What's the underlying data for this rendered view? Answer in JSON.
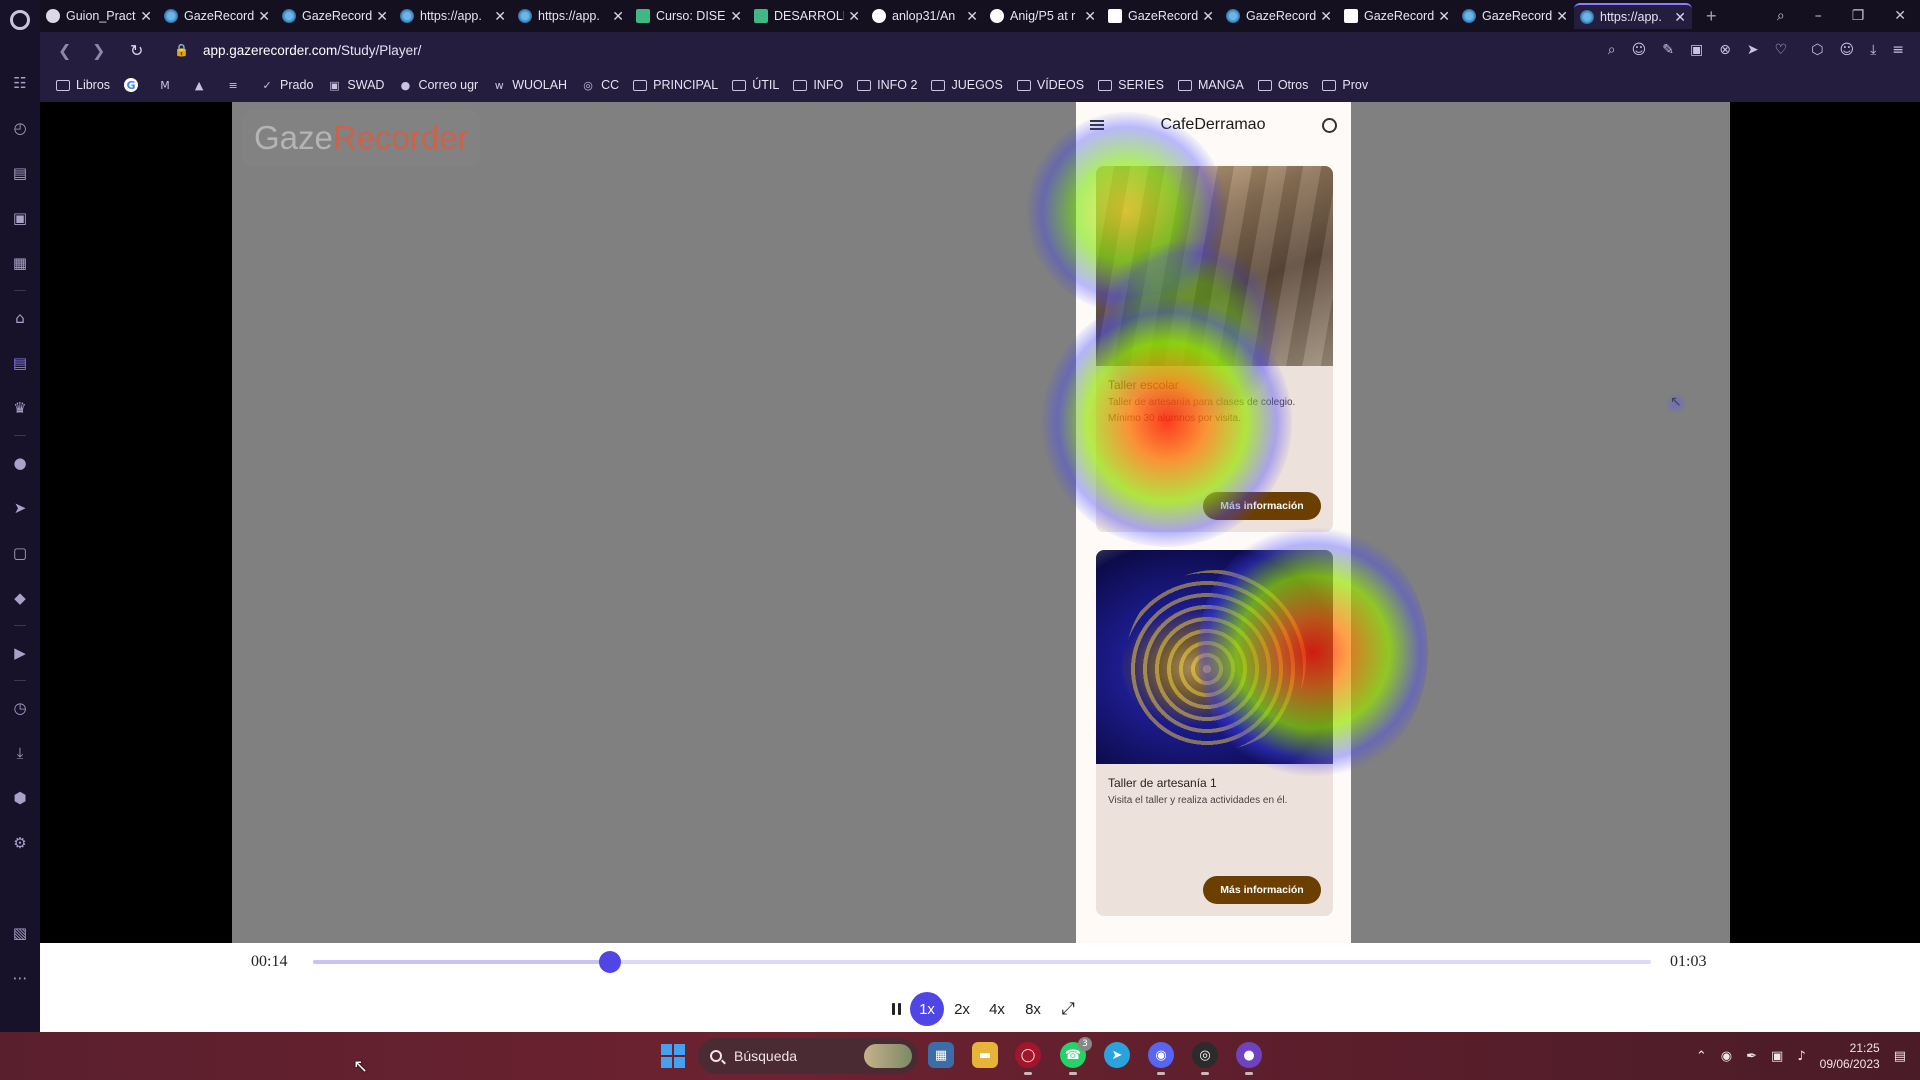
{
  "browser": {
    "tabs": [
      {
        "title": "Guion_Pract",
        "favicon": "opera-icon",
        "active": false
      },
      {
        "title": "GazeRecord",
        "favicon": "gazerecorder-icon",
        "active": false
      },
      {
        "title": "GazeRecord",
        "favicon": "gazerecorder-icon",
        "active": false
      },
      {
        "title": "https://app.",
        "favicon": "gazerecorder-icon",
        "active": false
      },
      {
        "title": "https://app.",
        "favicon": "gazerecorder-icon",
        "active": false
      },
      {
        "title": "Curso: DISE",
        "favicon": "vue-icon",
        "active": false
      },
      {
        "title": "DESARROLL",
        "favicon": "vue-icon",
        "active": false
      },
      {
        "title": "anlop31/An",
        "favicon": "github-icon",
        "active": false
      },
      {
        "title": "Anig/P5 at r",
        "favicon": "github-icon",
        "active": false
      },
      {
        "title": "GazeRecord",
        "favicon": "gmail-icon",
        "active": false
      },
      {
        "title": "GazeRecord",
        "favicon": "gazerecorder-icon",
        "active": false
      },
      {
        "title": "GazeRecord",
        "favicon": "gmail-icon",
        "active": false
      },
      {
        "title": "GazeRecord",
        "favicon": "gazerecorder-icon",
        "active": false
      },
      {
        "title": "https://app.",
        "favicon": "gazerecorder-icon",
        "active": true
      }
    ],
    "new_tab_label": "+",
    "url_host": "app.gazerecorder.com",
    "url_path": "/Study/Player/",
    "bookmarks": [
      {
        "label": "Libros",
        "icon": "folder-icon"
      },
      {
        "label": "",
        "icon": "google-icon"
      },
      {
        "label": "",
        "icon": "gmail-icon"
      },
      {
        "label": "",
        "icon": "drive-icon"
      },
      {
        "label": "",
        "icon": "docs-icon"
      },
      {
        "label": "Prado",
        "icon": "prado-icon"
      },
      {
        "label": "SWAD",
        "icon": "swad-icon"
      },
      {
        "label": "Correo ugr",
        "icon": "ugr-icon"
      },
      {
        "label": "WUOLAH",
        "icon": "wuolah-icon"
      },
      {
        "label": "CC",
        "icon": "cc-icon"
      },
      {
        "label": "PRINCIPAL",
        "icon": "folder-icon"
      },
      {
        "label": "ÚTIL",
        "icon": "folder-icon"
      },
      {
        "label": "INFO",
        "icon": "folder-icon"
      },
      {
        "label": "INFO 2",
        "icon": "folder-icon"
      },
      {
        "label": "JUEGOS",
        "icon": "folder-icon"
      },
      {
        "label": "VÍDEOS",
        "icon": "folder-icon"
      },
      {
        "label": "SERIES",
        "icon": "folder-icon"
      },
      {
        "label": "MANGA",
        "icon": "folder-icon"
      },
      {
        "label": "Otros",
        "icon": "folder-icon"
      },
      {
        "label": "Prov",
        "icon": "folder-icon"
      }
    ]
  },
  "overlay": {
    "logo_part1": "Gaze",
    "logo_part2": "Recorder"
  },
  "phone": {
    "app_title": "CafeDerramao",
    "cards": [
      {
        "title": "Taller escolar",
        "description": "Taller de artesanía para clases de colegio. Mínimo 30 alumnos por visita.",
        "button": "Más información"
      },
      {
        "title": "Taller de artesanía 1",
        "description": "Visita el taller y realiza actividades en él.",
        "button": "Más información"
      }
    ]
  },
  "player": {
    "current_time": "00:14",
    "total_time": "01:03",
    "progress_fraction": 0.2222,
    "speeds": [
      "1x",
      "2x",
      "4x",
      "8x"
    ],
    "active_speed": "1x",
    "accent_color": "#4f46e5"
  },
  "taskbar": {
    "search_placeholder": "Búsqueda",
    "clock_time": "21:25",
    "clock_date": "09/06/2023",
    "whatsapp_badge": "3"
  }
}
